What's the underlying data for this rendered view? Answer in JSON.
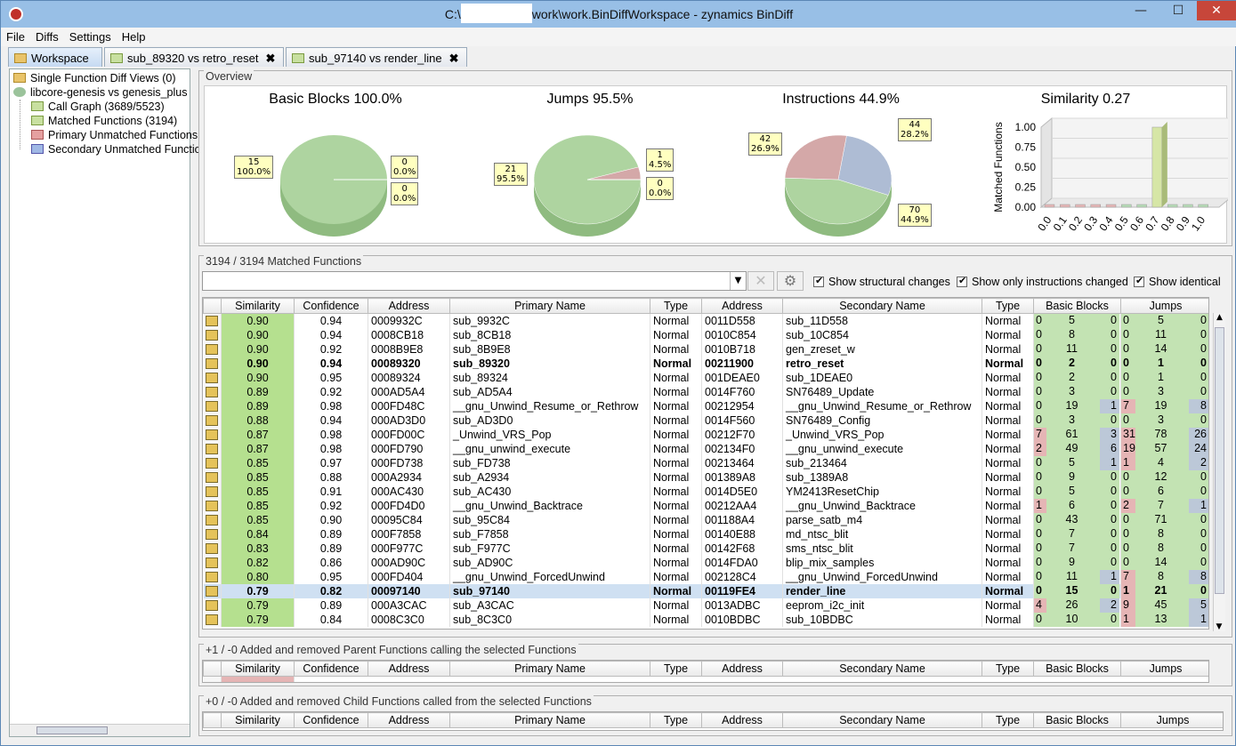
{
  "window": {
    "title_prefix": "C:\\",
    "title_suffix": "work\\work.BinDiffWorkspace - zynamics BinDiff",
    "minimize": "—",
    "maximize": "☐",
    "close": "✕"
  },
  "menu": [
    "File",
    "Diffs",
    "Settings",
    "Help"
  ],
  "tabs": [
    {
      "label": "Workspace"
    },
    {
      "label": "sub_89320 vs retro_reset",
      "close": "✖"
    },
    {
      "label": "sub_97140 vs render_line",
      "close": "✖"
    }
  ],
  "tree": [
    "Single Function Diff Views (0)",
    "libcore-genesis vs genesis_plus",
    "Call Graph (3689/5523)",
    "Matched Functions (3194)",
    "Primary Unmatched Functions",
    "Secondary Unmatched Functions"
  ],
  "overview": {
    "title": "Overview",
    "charts": [
      {
        "title": "Basic Blocks 100.0%",
        "labels": [
          "15\n100.0%",
          "0\n0.0%",
          "0\n0.0%"
        ],
        "chart_data": {
          "type": "pie",
          "values": [
            15,
            0,
            0
          ]
        }
      },
      {
        "title": "Jumps 95.5%",
        "labels": [
          "21\n95.5%",
          "1\n4.5%",
          "0\n0.0%"
        ],
        "chart_data": {
          "type": "pie",
          "values": [
            21,
            1,
            0
          ]
        }
      },
      {
        "title": "Instructions 44.9%",
        "labels": [
          "42\n26.9%",
          "44\n28.2%",
          "70\n44.9%"
        ],
        "chart_data": {
          "type": "pie",
          "values": [
            42,
            44,
            70
          ]
        }
      }
    ],
    "similarity": {
      "title": "Similarity 0.27",
      "chart_data": {
        "type": "bar",
        "ylabel": "Matched Functions",
        "categories": [
          "0.0",
          "0.1",
          "0.2",
          "0.3",
          "0.4",
          "0.5",
          "0.6",
          "0.7",
          "0.8",
          "0.9",
          "1.0"
        ],
        "values": [
          0,
          0,
          0,
          0,
          0,
          0,
          0,
          1,
          0,
          0,
          0
        ],
        "yticks": [
          "1.00",
          "0.75",
          "0.50",
          "0.25",
          "0.00"
        ],
        "ylim": [
          0,
          1
        ]
      }
    }
  },
  "matched": {
    "title": "3194 / 3194 Matched Functions",
    "options": [
      "Show structural changes",
      "Show only instructions changed",
      "Show identical"
    ],
    "columns": [
      "Similarity",
      "Confidence",
      "Address",
      "Primary Name",
      "Type",
      "Address",
      "Secondary Name",
      "Type",
      "Basic Blocks",
      "Jumps"
    ],
    "rows": [
      [
        "0.90",
        "0.94",
        "0009932C",
        "sub_9932C",
        "Normal",
        "0011D558",
        "sub_11D558",
        "Normal",
        [
          "0",
          "5",
          "0"
        ],
        [
          "0",
          "5",
          "0"
        ]
      ],
      [
        "0.90",
        "0.94",
        "0008CB18",
        "sub_8CB18",
        "Normal",
        "0010C854",
        "sub_10C854",
        "Normal",
        [
          "0",
          "8",
          "0"
        ],
        [
          "0",
          "11",
          "0"
        ]
      ],
      [
        "0.90",
        "0.92",
        "0008B9E8",
        "sub_8B9E8",
        "Normal",
        "0010B718",
        "gen_zreset_w",
        "Normal",
        [
          "0",
          "11",
          "0"
        ],
        [
          "0",
          "14",
          "0"
        ]
      ],
      [
        "0.90",
        "0.94",
        "00089320",
        "sub_89320",
        "Normal",
        "00211900",
        "retro_reset",
        "Normal",
        [
          "0",
          "2",
          "0"
        ],
        [
          "0",
          "1",
          "0"
        ]
      ],
      [
        "0.90",
        "0.95",
        "00089324",
        "sub_89324",
        "Normal",
        "001DEAE0",
        "sub_1DEAE0",
        "Normal",
        [
          "0",
          "2",
          "0"
        ],
        [
          "0",
          "1",
          "0"
        ]
      ],
      [
        "0.89",
        "0.92",
        "000AD5A4",
        "sub_AD5A4",
        "Normal",
        "0014F760",
        "SN76489_Update",
        "Normal",
        [
          "0",
          "3",
          "0"
        ],
        [
          "0",
          "3",
          "0"
        ]
      ],
      [
        "0.89",
        "0.98",
        "000FD48C",
        "__gnu_Unwind_Resume_or_Rethrow",
        "Normal",
        "00212954",
        "__gnu_Unwind_Resume_or_Rethrow",
        "Normal",
        [
          "0",
          "19",
          "1"
        ],
        [
          "7",
          "19",
          "8"
        ]
      ],
      [
        "0.88",
        "0.94",
        "000AD3D0",
        "sub_AD3D0",
        "Normal",
        "0014F560",
        "SN76489_Config",
        "Normal",
        [
          "0",
          "3",
          "0"
        ],
        [
          "0",
          "3",
          "0"
        ]
      ],
      [
        "0.87",
        "0.98",
        "000FD00C",
        "_Unwind_VRS_Pop",
        "Normal",
        "00212F70",
        "_Unwind_VRS_Pop",
        "Normal",
        [
          "7",
          "61",
          "3"
        ],
        [
          "31",
          "78",
          "26"
        ]
      ],
      [
        "0.87",
        "0.98",
        "000FD790",
        "__gnu_unwind_execute",
        "Normal",
        "002134F0",
        "__gnu_unwind_execute",
        "Normal",
        [
          "2",
          "49",
          "6"
        ],
        [
          "19",
          "57",
          "24"
        ]
      ],
      [
        "0.85",
        "0.97",
        "000FD738",
        "sub_FD738",
        "Normal",
        "00213464",
        "sub_213464",
        "Normal",
        [
          "0",
          "5",
          "1"
        ],
        [
          "1",
          "4",
          "2"
        ]
      ],
      [
        "0.85",
        "0.88",
        "000A2934",
        "sub_A2934",
        "Normal",
        "001389A8",
        "sub_1389A8",
        "Normal",
        [
          "0",
          "9",
          "0"
        ],
        [
          "0",
          "12",
          "0"
        ]
      ],
      [
        "0.85",
        "0.91",
        "000AC430",
        "sub_AC430",
        "Normal",
        "0014D5E0",
        "YM2413ResetChip",
        "Normal",
        [
          "0",
          "5",
          "0"
        ],
        [
          "0",
          "6",
          "0"
        ]
      ],
      [
        "0.85",
        "0.92",
        "000FD4D0",
        "__gnu_Unwind_Backtrace",
        "Normal",
        "00212AA4",
        "__gnu_Unwind_Backtrace",
        "Normal",
        [
          "1",
          "6",
          "0"
        ],
        [
          "2",
          "7",
          "1"
        ]
      ],
      [
        "0.85",
        "0.90",
        "00095C84",
        "sub_95C84",
        "Normal",
        "001188A4",
        "parse_satb_m4",
        "Normal",
        [
          "0",
          "43",
          "0"
        ],
        [
          "0",
          "71",
          "0"
        ]
      ],
      [
        "0.84",
        "0.89",
        "000F7858",
        "sub_F7858",
        "Normal",
        "00140E88",
        "md_ntsc_blit",
        "Normal",
        [
          "0",
          "7",
          "0"
        ],
        [
          "0",
          "8",
          "0"
        ]
      ],
      [
        "0.83",
        "0.89",
        "000F977C",
        "sub_F977C",
        "Normal",
        "00142F68",
        "sms_ntsc_blit",
        "Normal",
        [
          "0",
          "7",
          "0"
        ],
        [
          "0",
          "8",
          "0"
        ]
      ],
      [
        "0.82",
        "0.86",
        "000AD90C",
        "sub_AD90C",
        "Normal",
        "0014FDA0",
        "blip_mix_samples",
        "Normal",
        [
          "0",
          "9",
          "0"
        ],
        [
          "0",
          "14",
          "0"
        ]
      ],
      [
        "0.80",
        "0.95",
        "000FD404",
        "__gnu_Unwind_ForcedUnwind",
        "Normal",
        "002128C4",
        "__gnu_Unwind_ForcedUnwind",
        "Normal",
        [
          "0",
          "11",
          "1"
        ],
        [
          "7",
          "8",
          "8"
        ]
      ],
      [
        "0.79",
        "0.82",
        "00097140",
        "sub_97140",
        "Normal",
        "00119FE4",
        "render_line",
        "Normal",
        [
          "0",
          "15",
          "0"
        ],
        [
          "1",
          "21",
          "0"
        ]
      ],
      [
        "0.79",
        "0.89",
        "000A3CAC",
        "sub_A3CAC",
        "Normal",
        "0013ADBC",
        "eeprom_i2c_init",
        "Normal",
        [
          "4",
          "26",
          "2"
        ],
        [
          "9",
          "45",
          "5"
        ]
      ],
      [
        "0.79",
        "0.84",
        "0008C3C0",
        "sub_8C3C0",
        "Normal",
        "0010BDBC",
        "sub_10BDBC",
        "Normal",
        [
          "0",
          "10",
          "0"
        ],
        [
          "1",
          "13",
          "1"
        ]
      ]
    ]
  },
  "parents": {
    "title": "+1 / -0 Added and removed Parent Functions calling the selected Functions"
  },
  "children": {
    "title": "+0 / -0 Added and removed Child Functions called from the selected Functions"
  }
}
